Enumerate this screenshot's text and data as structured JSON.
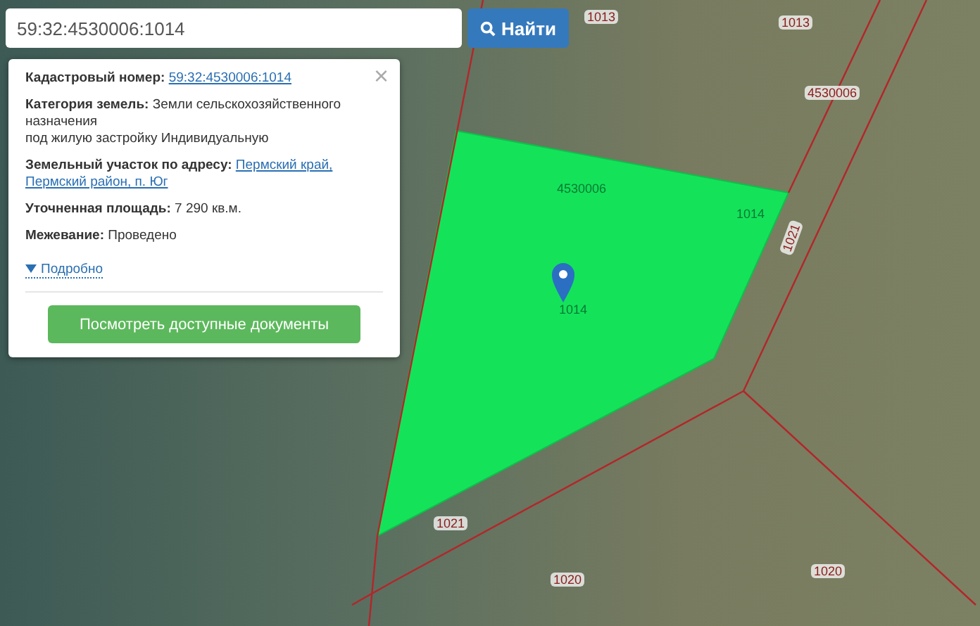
{
  "search": {
    "value": "59:32:4530006:1014",
    "button": "Найти"
  },
  "info_panel": {
    "close": "×",
    "fields": [
      {
        "label": "Кадастровый номер:",
        "parts": [
          {
            "text": "59:32:4530006:1014",
            "kind": "link"
          }
        ]
      },
      {
        "label": "Категория земель:",
        "parts": [
          {
            "text": "Земли сельскохозяйственного назначения",
            "kind": "text"
          },
          {
            "text": "под жилую застройку Индивидуальную",
            "kind": "text"
          }
        ]
      },
      {
        "label": "Земельный участок по адресу:",
        "parts": [
          {
            "text": "Пермский край,",
            "kind": "link"
          },
          {
            "text": "Пермский район, п. Юг",
            "kind": "link"
          }
        ]
      },
      {
        "label": "Уточненная площадь:",
        "parts": [
          {
            "text": "7 290 кв.м.",
            "kind": "text"
          }
        ]
      },
      {
        "label": "Межевание:",
        "parts": [
          {
            "text": "Проведено",
            "kind": "text"
          }
        ]
      }
    ],
    "details": {
      "label": "Подробно",
      "expanded": false
    },
    "button": "Посмотреть доступные документы"
  },
  "map": {
    "labels": [
      {
        "text": "1013",
        "kind": "boundary"
      },
      {
        "text": "1013",
        "kind": "boundary"
      },
      {
        "text": "4530006",
        "kind": "boundary"
      },
      {
        "text": "1021",
        "kind": "vertical"
      },
      {
        "text": "4530006",
        "kind": "faint"
      },
      {
        "text": "1014",
        "kind": "faint"
      },
      {
        "text": "1014",
        "kind": "faint"
      },
      {
        "text": "1021",
        "kind": "boundary"
      },
      {
        "text": "1020",
        "kind": "boundary"
      },
      {
        "text": "1020",
        "kind": "boundary"
      }
    ]
  }
}
